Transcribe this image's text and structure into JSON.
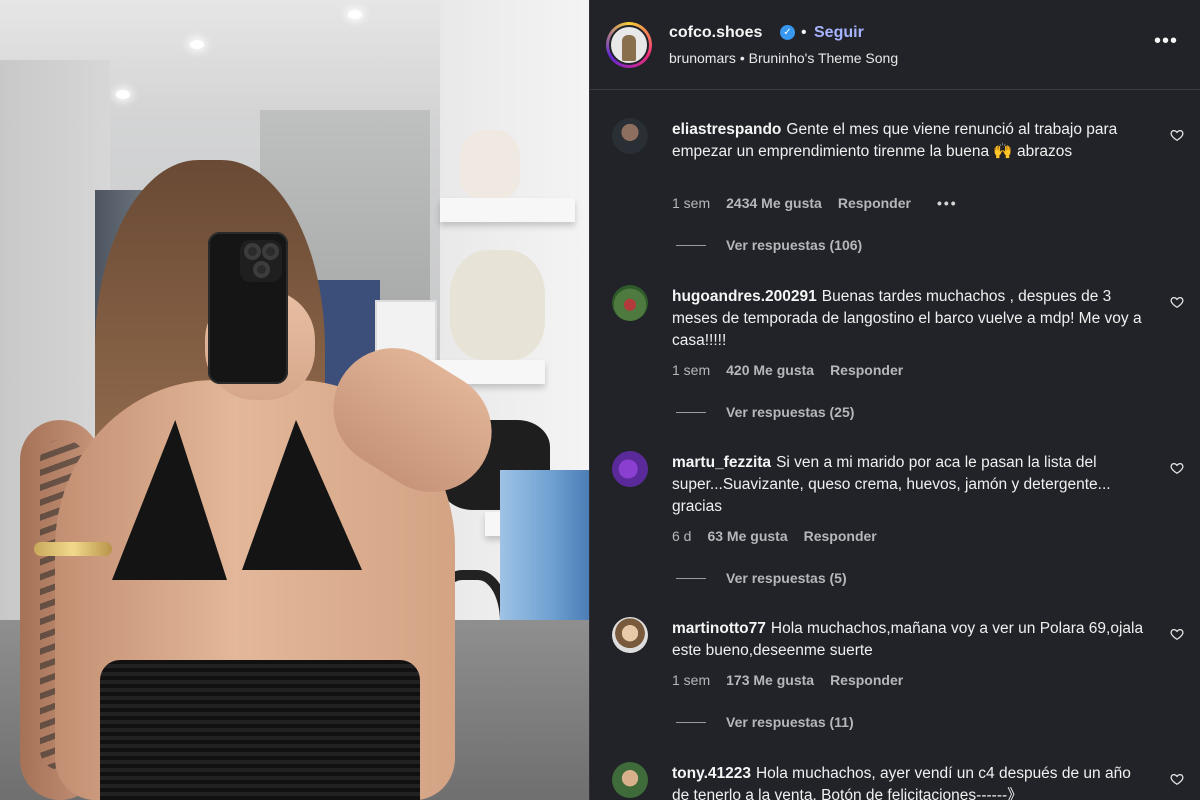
{
  "post": {
    "username": "cofco.shoes",
    "verified_mark": "✓",
    "separator": "•",
    "follow_label": "Seguir",
    "audio_artist": "brunomars",
    "audio_separator": "•",
    "audio_title": "Bruninho's Theme Song",
    "more_label": "•••"
  },
  "comments": [
    {
      "username": "eliastrespando",
      "text": "Gente el mes que viene renunció al trabajo para empezar un emprendimiento tirenme la buena 🙌 abrazos",
      "time": "1 sem",
      "likes": "2434 Me gusta",
      "reply": "Responder",
      "options": "•••",
      "view_replies": "Ver respuestas (106)"
    },
    {
      "username": "hugoandres.200291",
      "text": "Buenas tardes muchachos , despues de 3 meses de temporada de langostino el barco vuelve a mdp! Me voy a casa!!!!!",
      "time": "1 sem",
      "likes": "420 Me gusta",
      "reply": "Responder",
      "view_replies": "Ver respuestas (25)"
    },
    {
      "username": "martu_fezzita",
      "text": "Si ven a mi marido por aca le pasan la lista del super...Suavizante, queso crema, huevos, jamón y detergente... gracias",
      "time": "6 d",
      "likes": "63 Me gusta",
      "reply": "Responder",
      "view_replies": "Ver respuestas (5)"
    },
    {
      "username": "martinotto77",
      "text": "Hola muchachos,mañana voy a ver un Polara 69,ojala este bueno,deseenme suerte",
      "time": "1 sem",
      "likes": "173 Me gusta",
      "reply": "Responder",
      "view_replies": "Ver respuestas (11)"
    },
    {
      "username": "tony.41223",
      "text": "Hola muchachos, ayer vendí un c4 después de un año de tenerlo a la venta. Botón de felicitaciones------》"
    }
  ],
  "colors": {
    "panel_bg": "#212328",
    "link_blue": "#a7b4ff",
    "verified_blue": "#3897f0",
    "text_secondary": "#b5b7bb"
  },
  "icons": {
    "heart": "heart-outline-icon",
    "verified": "verified-badge-icon",
    "more": "more-options-icon"
  }
}
